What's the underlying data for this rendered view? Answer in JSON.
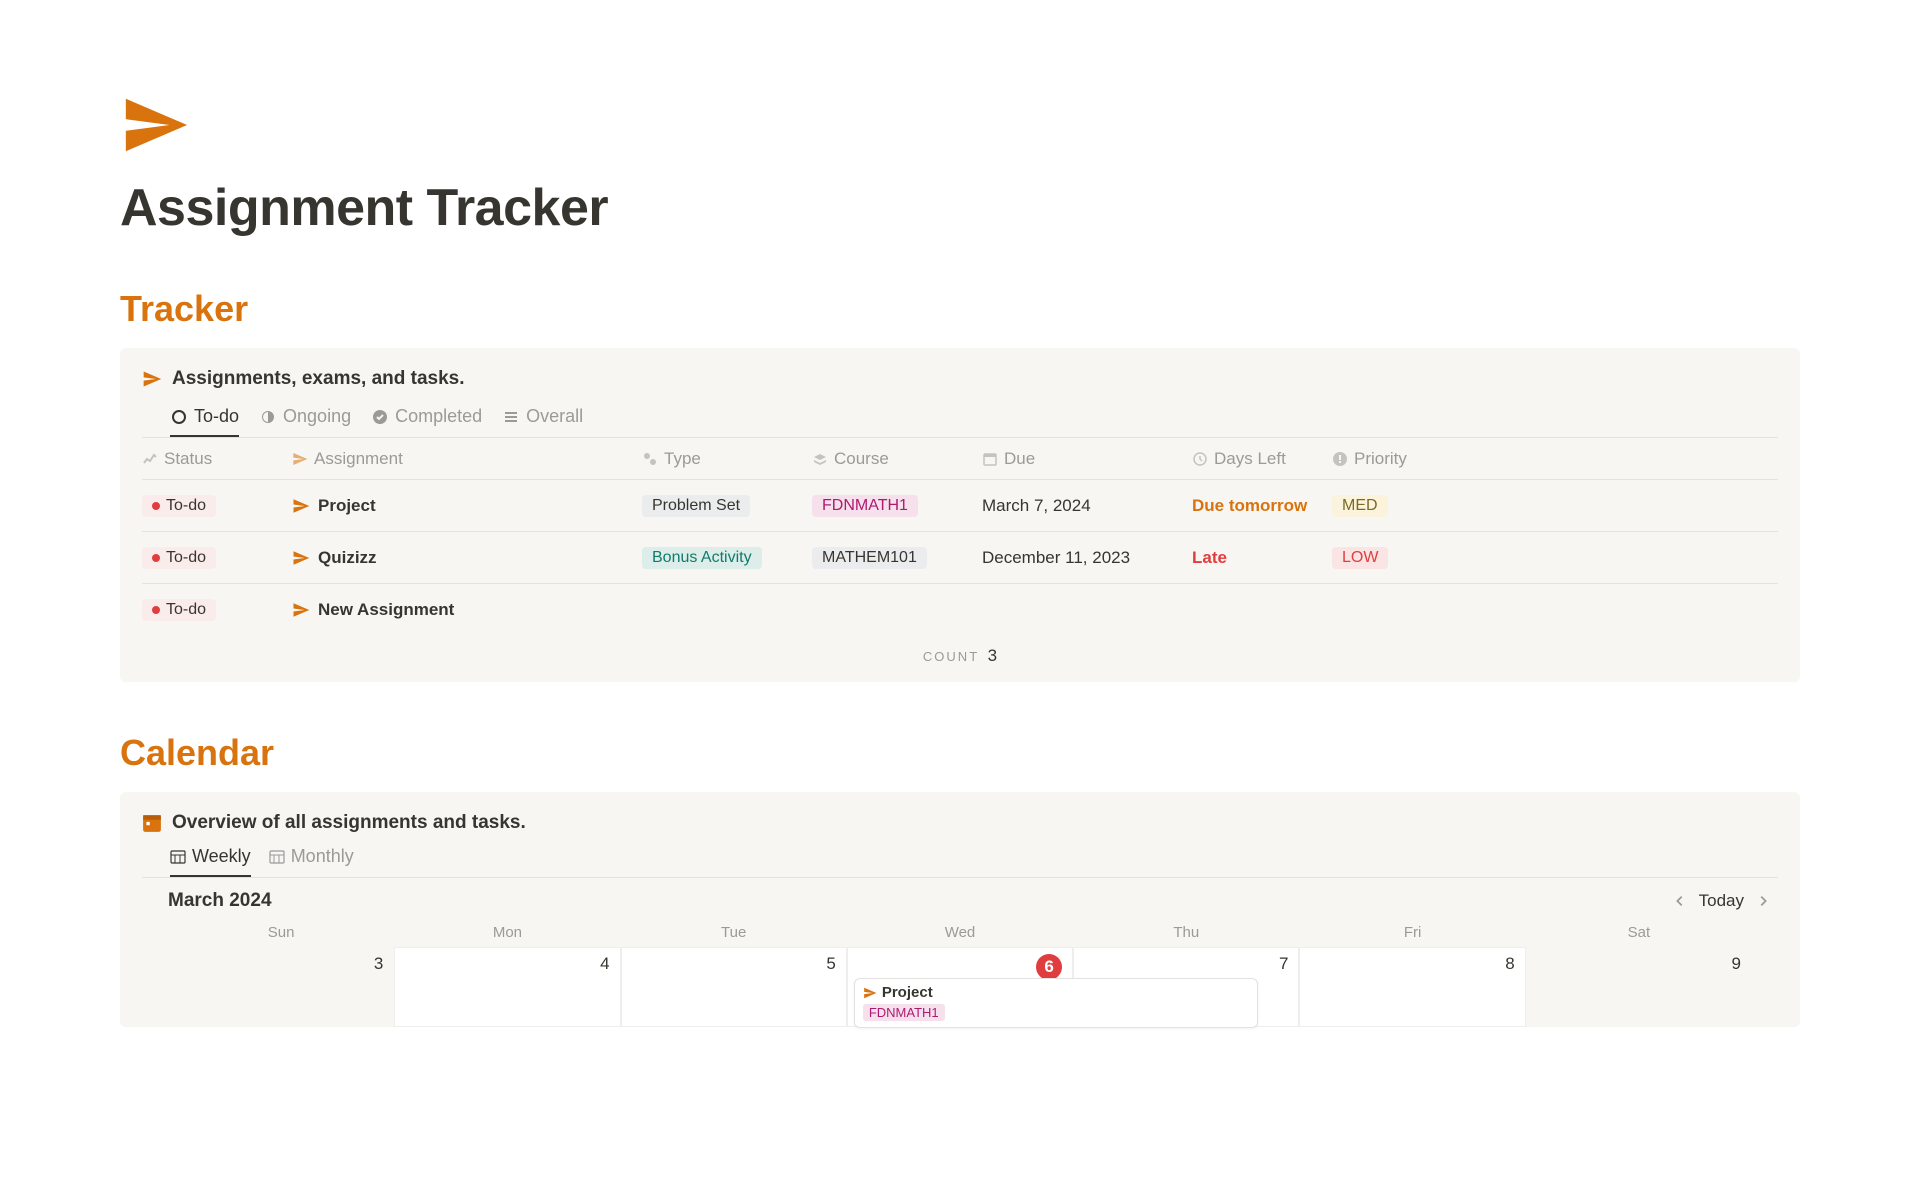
{
  "page": {
    "title": "Assignment Tracker"
  },
  "tracker": {
    "section_title": "Tracker",
    "callout": "Assignments, exams, and tasks.",
    "tabs": [
      {
        "label": "To-do",
        "active": true
      },
      {
        "label": "Ongoing",
        "active": false
      },
      {
        "label": "Completed",
        "active": false
      },
      {
        "label": "Overall",
        "active": false
      }
    ],
    "columns": {
      "status": "Status",
      "assignment": "Assignment",
      "type": "Type",
      "course": "Course",
      "due": "Due",
      "days_left": "Days Left",
      "priority": "Priority"
    },
    "rows": [
      {
        "status": "To-do",
        "assignment": "Project",
        "type": "Problem Set",
        "type_color": "grey",
        "course": "FDNMATH1",
        "course_color": "pink",
        "due": "March 7, 2024",
        "days_left": "Due tomorrow",
        "days_left_state": "warn",
        "priority": "MED",
        "priority_color": "yellow"
      },
      {
        "status": "To-do",
        "assignment": "Quizizz",
        "type": "Bonus Activity",
        "type_color": "green",
        "course": "MATHEM101",
        "course_color": "grey",
        "due": "December 11, 2023",
        "days_left": "Late",
        "days_left_state": "late",
        "priority": "LOW",
        "priority_color": "red"
      },
      {
        "status": "To-do",
        "assignment": "New Assignment",
        "type": "",
        "type_color": "",
        "course": "",
        "course_color": "",
        "due": "",
        "days_left": "",
        "days_left_state": "",
        "priority": "",
        "priority_color": ""
      }
    ],
    "count_label": "COUNT",
    "count_value": "3"
  },
  "calendar": {
    "section_title": "Calendar",
    "callout": "Overview of all assignments and tasks.",
    "tabs": [
      {
        "label": "Weekly",
        "active": true
      },
      {
        "label": "Monthly",
        "active": false
      }
    ],
    "month": "March 2024",
    "today_label": "Today",
    "weekdays": [
      "Sun",
      "Mon",
      "Tue",
      "Wed",
      "Thu",
      "Fri",
      "Sat"
    ],
    "days": [
      "3",
      "4",
      "5",
      "6",
      "7",
      "8",
      "9"
    ],
    "today_index": 3,
    "event": {
      "title": "Project",
      "course": "FDNMATH1",
      "course_color": "pink"
    }
  },
  "colors": {
    "accent": "#d9730d"
  }
}
